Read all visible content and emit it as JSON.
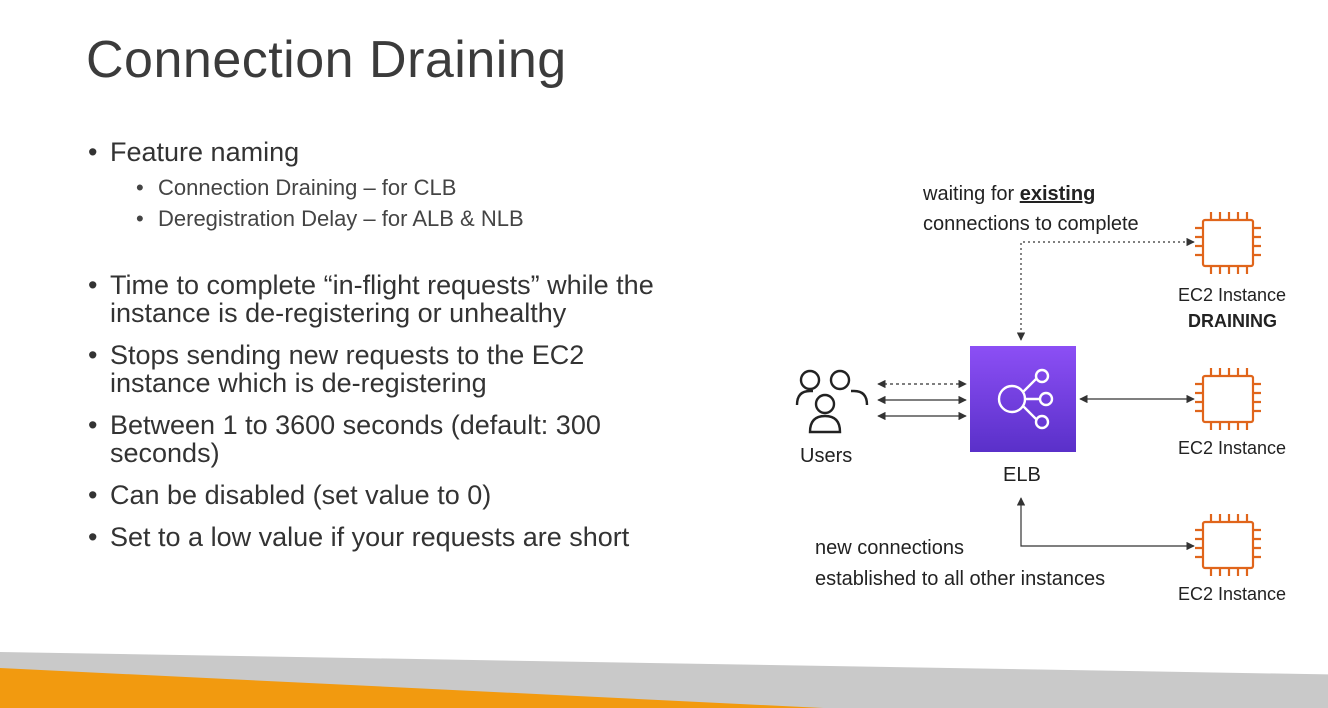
{
  "slide": {
    "title": "Connection Draining",
    "feature_naming": {
      "label": "Feature naming",
      "items": [
        "Connection Draining – for CLB",
        "Deregistration Delay – for ALB & NLB"
      ]
    },
    "bullets": [
      [
        "Time to complete “in-flight requests” while the",
        "instance is de-registering or unhealthy"
      ],
      [
        "Stops sending new requests to the EC2",
        "instance which is de-registering"
      ],
      [
        "Between 1 to 3600 seconds (default: 300",
        "seconds)"
      ],
      [
        "Can be disabled (set value to 0)"
      ],
      [
        "Set to a low value if your requests are short"
      ]
    ]
  },
  "diagram": {
    "waiting_prefix": "waiting for ",
    "waiting_emph": "existing",
    "waiting_line2": "connections to complete",
    "new_line1": "new connections",
    "new_line2": "established to all other instances",
    "users_label": "Users",
    "elb_label": "ELB",
    "ec2_label": "EC2 Instance",
    "draining_label": "DRAINING",
    "colors": {
      "ec2": "#e0651b",
      "elb_top": "#8c4ff5",
      "elb_bottom": "#5a30c9",
      "footer_orange": "#f29a0f",
      "footer_gray": "#c9c9c9"
    }
  }
}
